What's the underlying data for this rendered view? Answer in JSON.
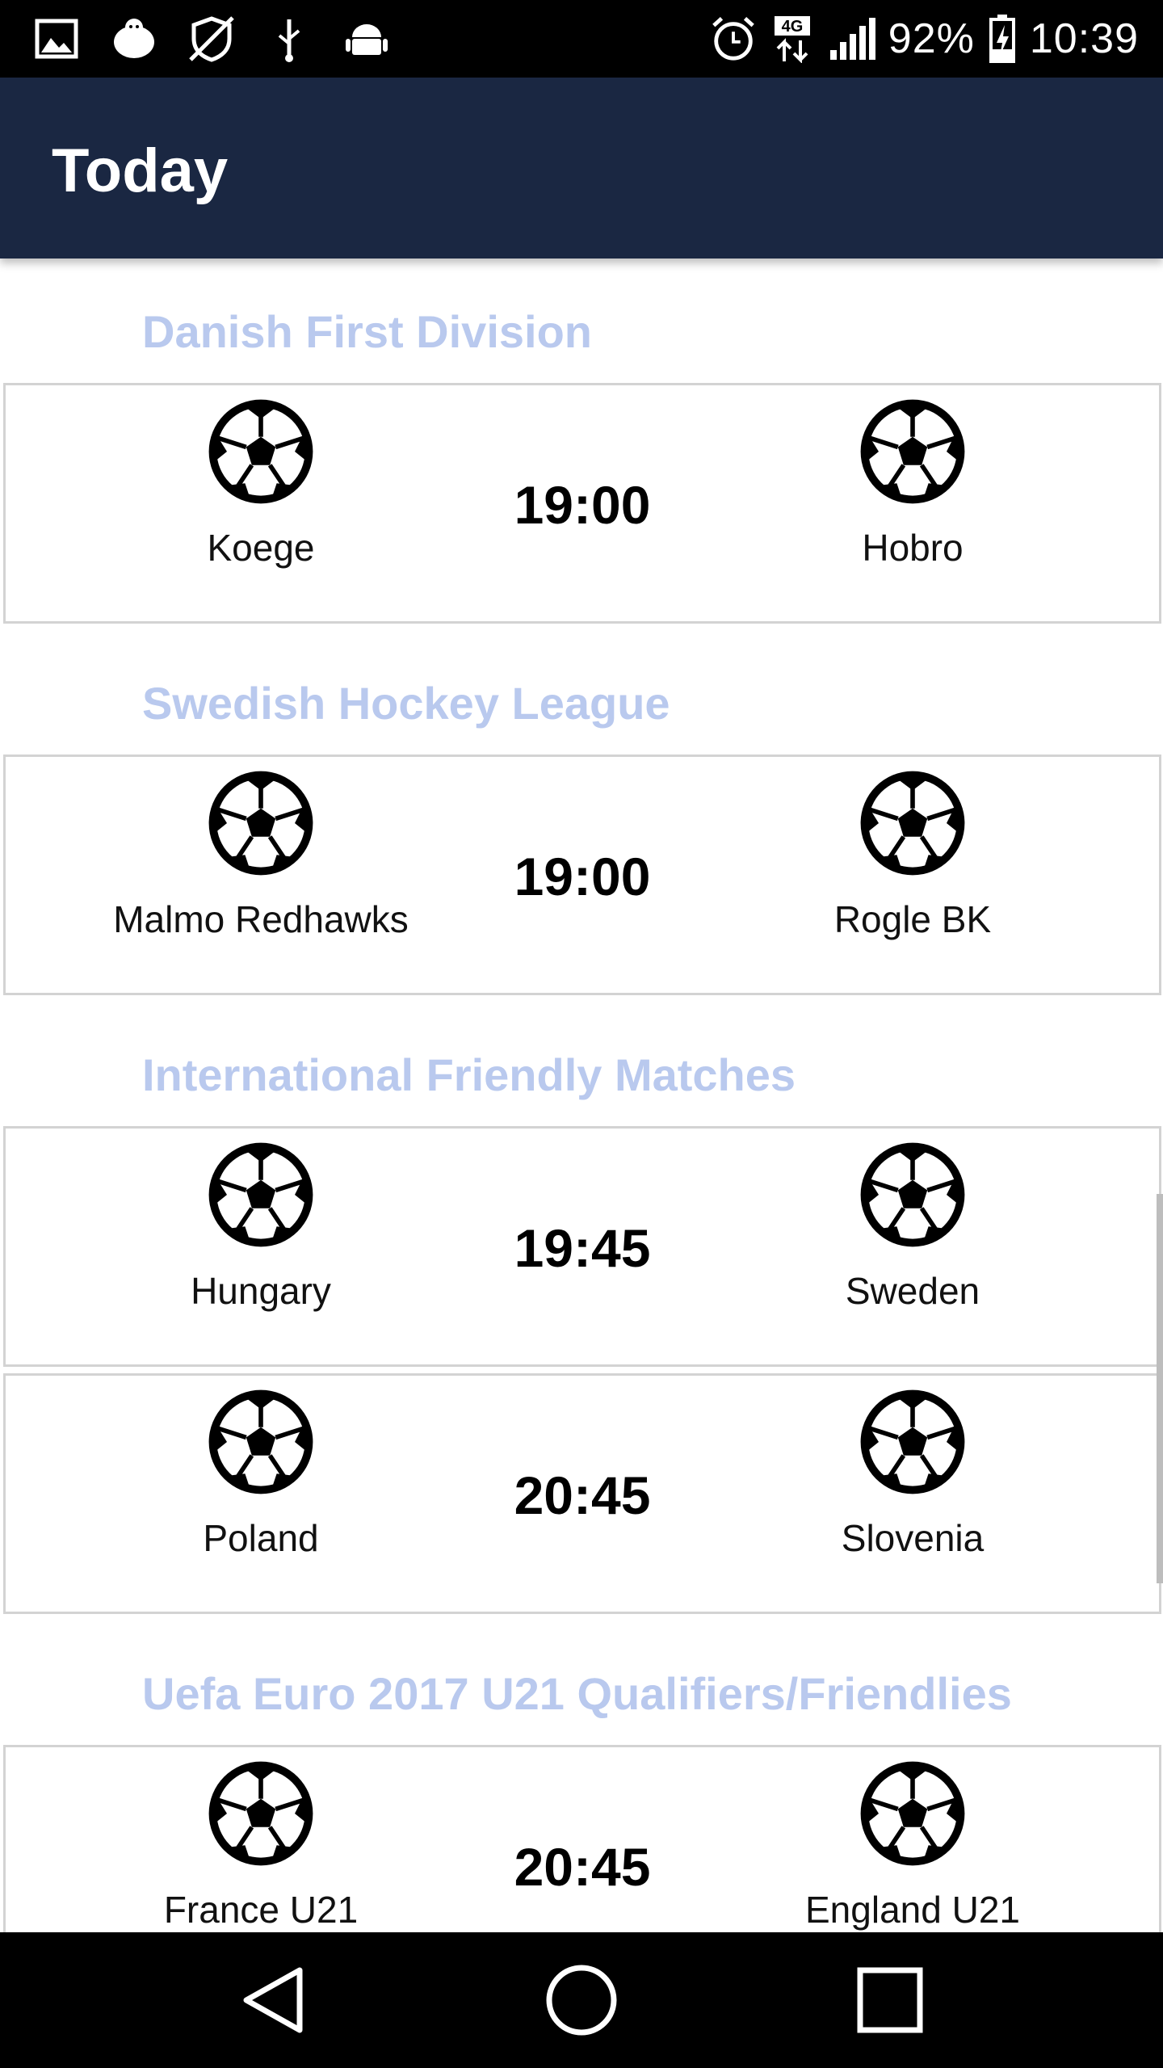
{
  "status_bar": {
    "battery": "92%",
    "time": "10:39",
    "network": "4G",
    "left_icons": [
      "image-icon",
      "bird-icon",
      "no-location-icon",
      "usb-icon",
      "android-icon"
    ],
    "right_icons": [
      "alarm-icon",
      "4g-data-icon",
      "signal-icon",
      "battery-charging-icon"
    ]
  },
  "app_bar": {
    "title": "Today"
  },
  "leagues": [
    {
      "name": "Danish First Division",
      "matches": [
        {
          "home": "Koege",
          "time": "19:00",
          "away": "Hobro"
        }
      ]
    },
    {
      "name": "Swedish Hockey League",
      "matches": [
        {
          "home": "Malmo Redhawks",
          "time": "19:00",
          "away": "Rogle BK"
        }
      ]
    },
    {
      "name": "International Friendly Matches",
      "matches": [
        {
          "home": "Hungary",
          "time": "19:45",
          "away": "Sweden"
        },
        {
          "home": "Poland",
          "time": "20:45",
          "away": "Slovenia"
        }
      ]
    },
    {
      "name": "Uefa Euro 2017 U21 Qualifiers/Friendlies",
      "matches": [
        {
          "home": "France U21",
          "time": "20:45",
          "away": "England U21"
        }
      ]
    }
  ],
  "nav_bar": {
    "icons": [
      "back-icon",
      "home-icon",
      "recents-icon"
    ]
  },
  "colors": {
    "app_bar_bg": "#1a2742",
    "league_header": "#b9c9ee",
    "card_border": "#d3d3d3"
  }
}
